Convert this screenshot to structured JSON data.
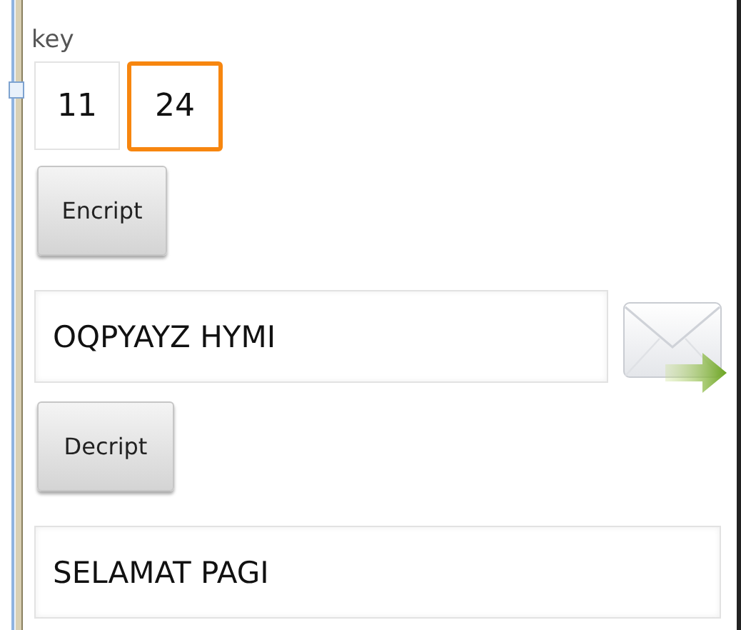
{
  "key_label": "key",
  "key_fields": [
    {
      "value": "11",
      "focused": false
    },
    {
      "value": "24",
      "focused": true
    }
  ],
  "encrypt_button": "Encript",
  "cipher_field": {
    "value": "OQPYAYZ HYMI"
  },
  "decrypt_button": "Decript",
  "plain_field": {
    "value": "SELAMAT PAGI"
  }
}
